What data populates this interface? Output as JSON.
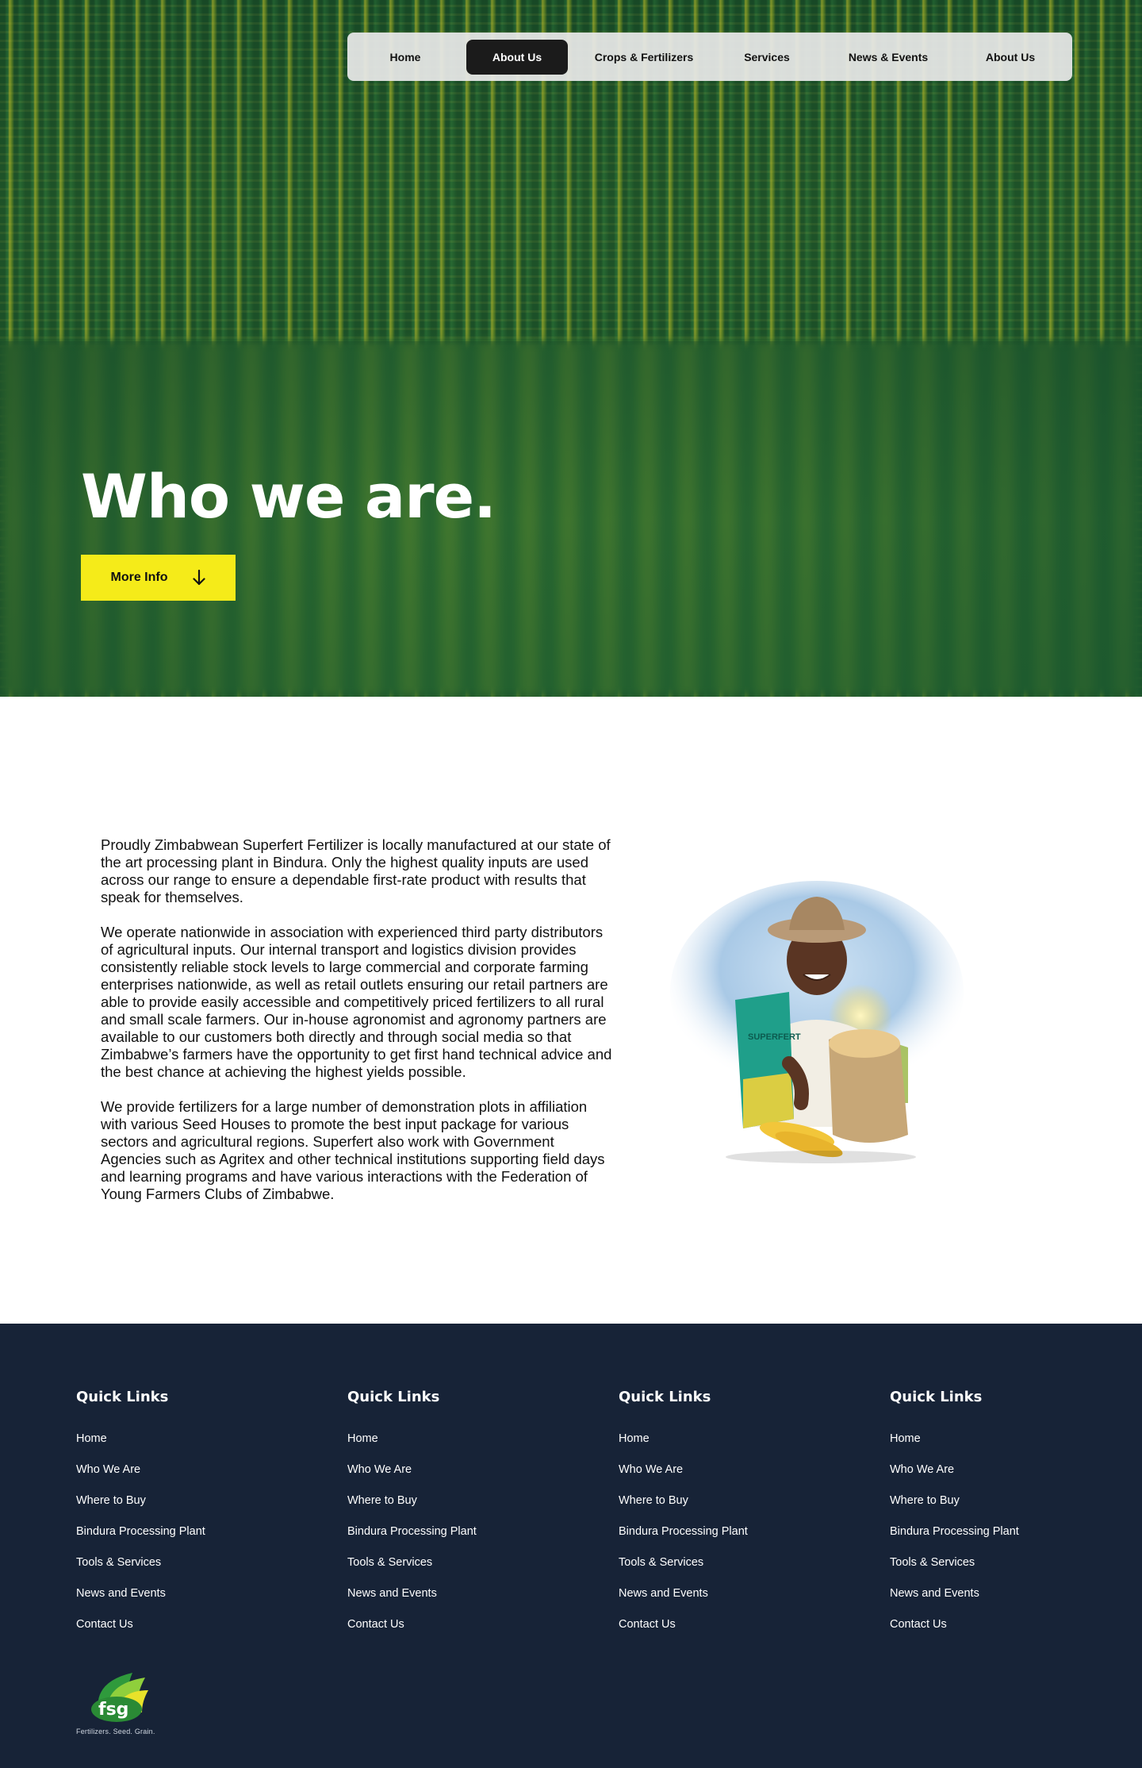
{
  "nav": {
    "items": [
      {
        "label": "Home",
        "active": false
      },
      {
        "label": "About Us",
        "active": true
      },
      {
        "label": "Crops & Fertilizers",
        "active": false
      },
      {
        "label": "Services",
        "active": false
      },
      {
        "label": "News & Events",
        "active": false
      },
      {
        "label": "About Us",
        "active": false
      }
    ]
  },
  "hero": {
    "title": "Who we are.",
    "button_label": "More Info",
    "button_icon": "arrow-down-icon",
    "button_color": "#f5eb19"
  },
  "content": {
    "paragraphs": [
      "Proudly Zimbabwean Superfert Fertilizer is locally manufactured at our state of the art processing plant in Bindura. Only the highest quality inputs are used across our range to ensure a dependable first-rate product with results that speak for themselves.",
      "We operate nationwide in association with experienced third party distributors of agricultural inputs. Our internal transport and logistics division provides consistently reliable stock levels to large commercial and corporate farming enterprises nationwide, as well as retail outlets ensuring our retail partners are able to provide easily accessible and competitively priced fertilizers to all rural and small scale farmers. Our in-house agronomist and agronomy partners are available to our customers both directly and through social media so that Zimbabwe’s farmers have the opportunity to get first hand technical advice and the best chance at achieving the highest yields possible.",
      "We provide fertilizers for a large number of demonstration plots in affiliation with various Seed Houses to promote the best input package for various sectors and agricultural regions. Superfert also work with Government Agencies such as Agritex and other technical institutions supporting field days and learning programs and have various interactions with the Federation of Young Farmers Clubs of Zimbabwe."
    ],
    "image_bag_label": "SUPERFERT"
  },
  "footer": {
    "background": "#172337",
    "columns": [
      {
        "heading": "Quick Links",
        "links": [
          "Home",
          "Who We Are",
          "Where to Buy",
          "Bindura Processing Plant",
          "Tools & Services",
          "News and Events",
          "Contact Us"
        ]
      },
      {
        "heading": "Quick Links",
        "links": [
          "Home",
          "Who We Are",
          "Where to Buy",
          "Bindura Processing Plant",
          "Tools & Services",
          "News and Events",
          "Contact Us"
        ]
      },
      {
        "heading": "Quick Links",
        "links": [
          "Home",
          "Who We Are",
          "Where to Buy",
          "Bindura Processing Plant",
          "Tools & Services",
          "News and Events",
          "Contact Us"
        ]
      },
      {
        "heading": "Quick Links",
        "links": [
          "Home",
          "Who We Are",
          "Where to Buy",
          "Bindura Processing Plant",
          "Tools & Services",
          "News and Events",
          "Contact Us"
        ]
      }
    ],
    "logo": {
      "text": "fsg",
      "tagline": "Fertilizers. Seed. Grain."
    }
  }
}
